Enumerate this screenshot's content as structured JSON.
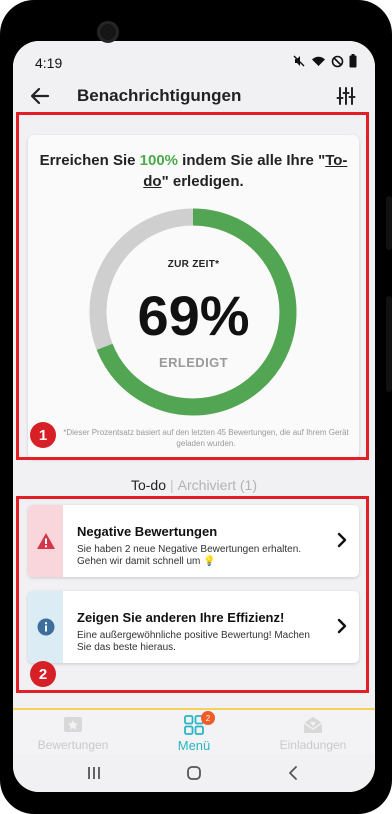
{
  "status_bar": {
    "time": "4:19",
    "icons": [
      "mute-icon",
      "wifi-icon",
      "dnd-icon",
      "battery-icon"
    ]
  },
  "app_bar": {
    "title": "Benachrichtigungen"
  },
  "progress_card": {
    "headline_prefix": "Erreichen Sie ",
    "headline_target": "100%",
    "headline_middle": " indem Sie alle Ihre \"",
    "headline_link": "To-do",
    "headline_suffix": "\" erledigen.",
    "current_label": "ZUR ZEIT*",
    "percent_text": "69%",
    "percent_value": 69,
    "done_label": "ERLEDIGT",
    "footnote": "*Dieser Prozentsatz basiert auf den letzten 45 Bewertungen, die auf Ihrem Gerät geladen wurden.",
    "progress_color": "#52a552",
    "track_color": "#cfcfcf"
  },
  "annotations": {
    "badge_1": "1",
    "badge_2": "2",
    "frame_color": "#e21f26"
  },
  "tabs": {
    "active": "To-do",
    "separator": "|",
    "inactive": "Archiviert (1)"
  },
  "notifications": [
    {
      "icon": "warning-icon",
      "title": "Negative Bewertungen",
      "text": "Sie haben 2 neue Negative Bewertungen erhalten. Gehen wir damit schnell um 💡",
      "stripe_color": "#f8d6dc"
    },
    {
      "icon": "info-icon",
      "title": "Zeigen Sie anderen Ihre Effizienz!",
      "text": "Eine außergewöhnliche positive Bewertung! Machen Sie das beste hieraus.",
      "stripe_color": "#dcecf5"
    }
  ],
  "bottom_nav": {
    "items": [
      {
        "label": "Bewertungen",
        "icon": "reviews-icon"
      },
      {
        "label": "Menü",
        "icon": "menu-grid-icon",
        "badge": "2"
      },
      {
        "label": "Einladungen",
        "icon": "invitations-icon"
      }
    ],
    "accent": "#29b6c4"
  },
  "system_nav": [
    "recents-icon",
    "home-icon",
    "back-icon"
  ]
}
